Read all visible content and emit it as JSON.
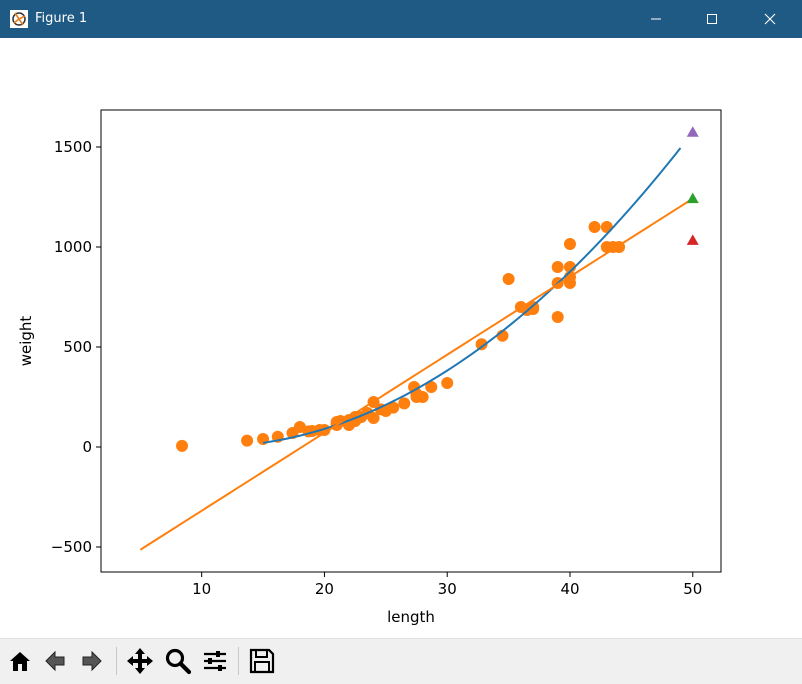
{
  "window": {
    "title": "Figure 1"
  },
  "toolbar": {
    "buttons": [
      "home",
      "back",
      "forward",
      "pan",
      "zoom",
      "configure-subplots",
      "save"
    ]
  },
  "chart_data": {
    "type": "scatter",
    "xlabel": "length",
    "ylabel": "weight",
    "xlim": [
      1.8,
      52.3
    ],
    "ylim": [
      -625,
      1685
    ],
    "xticks": [
      10,
      20,
      30,
      40,
      50
    ],
    "yticks": [
      -500,
      0,
      500,
      1000,
      1500
    ],
    "grid": false,
    "series": [
      {
        "kind": "scatter-points",
        "marker": "circle",
        "color": "#ff7f0e",
        "x": [
          8.4,
          13.7,
          15.0,
          16.2,
          17.4,
          18.0,
          18.7,
          19.0,
          19.6,
          20.0,
          21.0,
          21.0,
          21.0,
          21.3,
          22.0,
          22.0,
          22.0,
          22.0,
          22.0,
          22.5,
          22.5,
          22.7,
          23.0,
          23.5,
          24.0,
          24.0,
          24.6,
          25.0,
          25.6,
          26.5,
          27.3,
          27.5,
          27.5,
          27.5,
          28.0,
          28.7,
          30.0,
          32.8,
          34.5,
          35.0,
          36.5,
          36.0,
          37.0,
          37.0,
          39.0,
          39.0,
          39.0,
          40.0,
          40.0,
          40.0,
          40.0,
          42.0,
          43.0,
          43.0,
          43.5,
          44.0
        ],
        "y": [
          5.9,
          32.0,
          40.0,
          51.5,
          70.0,
          100.0,
          78.0,
          80.0,
          85.0,
          85.0,
          110.0,
          115.0,
          125.0,
          130.0,
          120.0,
          120.0,
          130.0,
          135.0,
          110.0,
          130.0,
          150.0,
          145.0,
          150.0,
          170.0,
          225.0,
          145.0,
          188.0,
          180.0,
          197.0,
          218.0,
          300.0,
          260.0,
          265.0,
          250.0,
          250.0,
          300.0,
          320.0,
          514.0,
          556.0,
          840.0,
          685.0,
          700.0,
          700.0,
          690.0,
          900.0,
          650.0,
          820.0,
          850.0,
          900.0,
          1015.0,
          820.0,
          1100.0,
          1000.0,
          1100.0,
          1000.0,
          1000.0
        ]
      },
      {
        "kind": "line",
        "color": "#1f77b4",
        "fit": "quadratic",
        "coefficients": [
          1.01433211,
          -21.55792498,
          116.0502107
        ],
        "x_range": [
          15,
          49
        ]
      },
      {
        "kind": "line",
        "color": "#ff7f0e",
        "fit": "linear",
        "coefficients": [
          39.01714496,
          -709.0186449
        ],
        "x_range": [
          5,
          50
        ]
      },
      {
        "kind": "scatter-points",
        "marker": "triangle",
        "color": "#2ca02c",
        "x": [
          50
        ],
        "y": [
          1241.84
        ]
      },
      {
        "kind": "scatter-points",
        "marker": "triangle",
        "color": "#d62728",
        "x": [
          50
        ],
        "y": [
          1033.33
        ]
      },
      {
        "kind": "scatter-points",
        "marker": "triangle",
        "color": "#9467bd",
        "x": [
          50
        ],
        "y": [
          1573.98
        ]
      }
    ]
  }
}
